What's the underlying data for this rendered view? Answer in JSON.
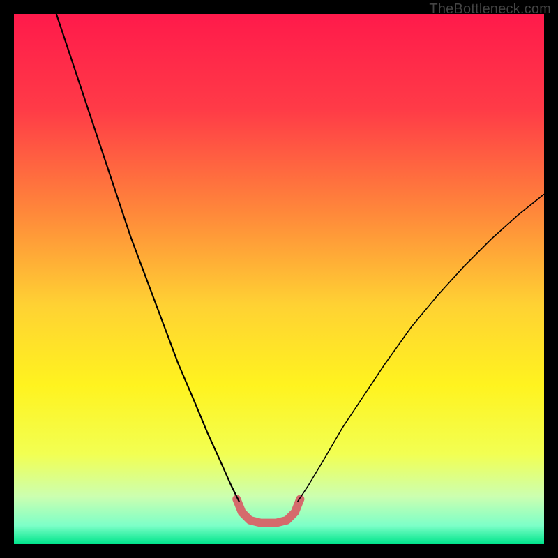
{
  "watermark": "TheBottleneck.com",
  "chart_data": {
    "type": "line",
    "title": "",
    "xlabel": "",
    "ylabel": "",
    "xlim": [
      0,
      100
    ],
    "ylim": [
      0,
      100
    ],
    "grid": false,
    "legend": false,
    "background_gradient": {
      "stops": [
        {
          "pos": 0.0,
          "color": "#ff1a4b"
        },
        {
          "pos": 0.18,
          "color": "#ff3b47"
        },
        {
          "pos": 0.38,
          "color": "#ff8a3a"
        },
        {
          "pos": 0.55,
          "color": "#ffd233"
        },
        {
          "pos": 0.7,
          "color": "#fff31f"
        },
        {
          "pos": 0.83,
          "color": "#f2ff52"
        },
        {
          "pos": 0.91,
          "color": "#ccffb0"
        },
        {
          "pos": 0.965,
          "color": "#7dffc8"
        },
        {
          "pos": 1.0,
          "color": "#00e58b"
        }
      ]
    },
    "series": [
      {
        "name": "left-arm",
        "stroke": "#000000",
        "stroke_width": 2.2,
        "points": [
          {
            "x": 8.0,
            "y": 100.0
          },
          {
            "x": 10.0,
            "y": 94.0
          },
          {
            "x": 13.0,
            "y": 85.0
          },
          {
            "x": 16.0,
            "y": 76.0
          },
          {
            "x": 19.0,
            "y": 67.0
          },
          {
            "x": 22.0,
            "y": 58.0
          },
          {
            "x": 25.0,
            "y": 50.0
          },
          {
            "x": 28.0,
            "y": 42.0
          },
          {
            "x": 31.0,
            "y": 34.0
          },
          {
            "x": 34.0,
            "y": 27.0
          },
          {
            "x": 36.5,
            "y": 21.0
          },
          {
            "x": 39.0,
            "y": 15.5
          },
          {
            "x": 41.0,
            "y": 11.0
          },
          {
            "x": 42.5,
            "y": 8.0
          }
        ]
      },
      {
        "name": "right-arm",
        "stroke": "#000000",
        "stroke_width": 1.6,
        "points": [
          {
            "x": 53.5,
            "y": 8.0
          },
          {
            "x": 55.5,
            "y": 11.0
          },
          {
            "x": 58.5,
            "y": 16.0
          },
          {
            "x": 62.0,
            "y": 22.0
          },
          {
            "x": 66.0,
            "y": 28.0
          },
          {
            "x": 70.0,
            "y": 34.0
          },
          {
            "x": 75.0,
            "y": 41.0
          },
          {
            "x": 80.0,
            "y": 47.0
          },
          {
            "x": 85.0,
            "y": 52.5
          },
          {
            "x": 90.0,
            "y": 57.5
          },
          {
            "x": 95.0,
            "y": 62.0
          },
          {
            "x": 100.0,
            "y": 66.0
          }
        ]
      },
      {
        "name": "valley-highlight",
        "stroke": "#d56a6c",
        "stroke_width": 12,
        "linecap": "round",
        "points": [
          {
            "x": 42.0,
            "y": 8.5
          },
          {
            "x": 43.0,
            "y": 6.0
          },
          {
            "x": 44.5,
            "y": 4.5
          },
          {
            "x": 46.5,
            "y": 4.0
          },
          {
            "x": 49.5,
            "y": 4.0
          },
          {
            "x": 51.5,
            "y": 4.5
          },
          {
            "x": 53.0,
            "y": 6.0
          },
          {
            "x": 54.0,
            "y": 8.5
          }
        ]
      }
    ]
  }
}
